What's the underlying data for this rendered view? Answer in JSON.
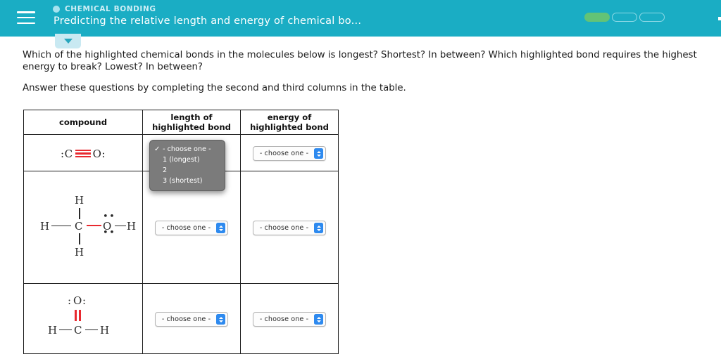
{
  "header": {
    "menu_icon": "hamburger-menu-icon",
    "category_icon": "circle-icon",
    "category": "CHEMICAL BONDING",
    "title": "Predicting the relative length and energy of chemical bo...",
    "progress": {
      "segments": [
        "filled",
        "empty",
        "empty"
      ],
      "filled_color": "#63c376",
      "track_color": "#8fd9e6"
    },
    "background_color": "#1aadc4"
  },
  "collapse_tab": {
    "icon": "chevron-down-icon"
  },
  "prompt": {
    "line1": "Which of the highlighted chemical bonds in the molecules below is longest? Shortest? In between? Which highlighted bond requires the highest energy to break? Lowest? In between?",
    "line2": "Answer these questions by completing the second and third columns in the table."
  },
  "table": {
    "headers": {
      "compound": "compound",
      "length": "length of highlighted bond",
      "energy": "energy of highlighted bond"
    },
    "rows": [
      {
        "compound_name": "carbon-monoxide",
        "length_select": "- choose one -",
        "energy_select": "- choose one -",
        "molecule": {
          "left_lone_pair": ":",
          "left_atom": "C",
          "bond": "triple-bond",
          "right_atom": "O",
          "right_lone_pair": ":"
        }
      },
      {
        "compound_name": "methanol",
        "length_select": "- choose one -",
        "energy_select": "- choose one -",
        "molecule": {
          "top_h": "H",
          "left_h": "H",
          "carbon": "C",
          "oxygen": "O",
          "right_h": "H",
          "bottom_h": "H",
          "highlighted_bond": "C-O"
        }
      },
      {
        "compound_name": "formaldehyde",
        "length_select": "- choose one -",
        "energy_select": "- choose one -",
        "molecule": {
          "oxygen_lone_left": ":",
          "oxygen": "O",
          "oxygen_lone_right": ":",
          "left_h": "H",
          "carbon": "C",
          "right_h": "H",
          "highlighted_bond": "C=O double"
        }
      }
    ]
  },
  "dropdown": {
    "open": true,
    "selected": "- choose one -",
    "check_glyph": "✓",
    "options": [
      "- choose one -",
      "1 (longest)",
      "2",
      "3 (shortest)"
    ],
    "background_color": "#7b7b7b"
  },
  "colors": {
    "teal": "#1aadc4",
    "highlight_red": "#e8292f",
    "stepper_blue": "#2e8aef",
    "tab_blue": "#c9e9f2"
  }
}
